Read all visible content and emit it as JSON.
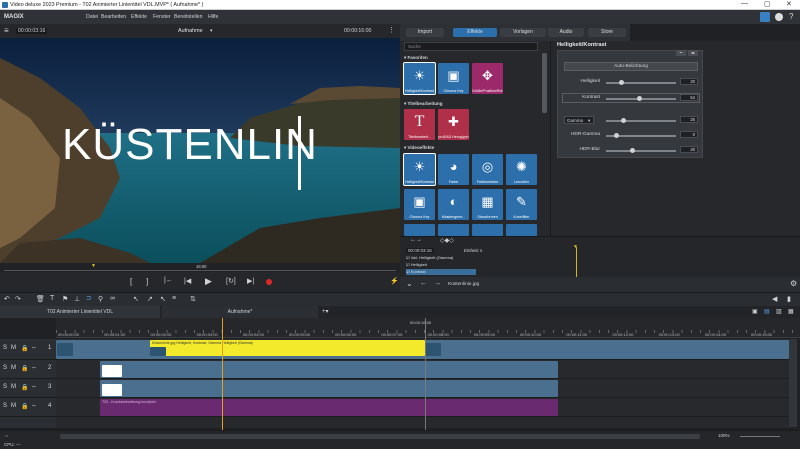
{
  "window": {
    "title": "Video deluxe 2023 Premium - T02 Animierter Linientitel VDL.MVP* ( Aufnahme* )"
  },
  "menubar": {
    "logo": "MAGIX",
    "items": [
      "Datei",
      "Bearbeiten",
      "Effekte",
      "Fenster",
      "Bereitstellen",
      "Hilfe"
    ]
  },
  "preview": {
    "timecode_left": "00:00:03:16",
    "title": "Aufnahme",
    "timecode_right": "00:00:16:00",
    "overlay_text": "KÜSTENLIN",
    "position_label": "16:00"
  },
  "tabs": [
    "Import",
    "Effekte",
    "Vorlagen",
    "Audio",
    "Store"
  ],
  "active_tab": "Effekte",
  "search": {
    "placeholder": "Suche"
  },
  "effects": {
    "sections": [
      {
        "title": "Favoriten",
        "tiles": [
          "Helligkeit/Kontrast",
          "Chroma Key",
          "Größe/Position/Rot..."
        ]
      },
      {
        "title": "Titelbearbeitung",
        "tiles": [
          "Titelbearbeit...",
          "proDAD Heroglyph"
        ]
      },
      {
        "title": "Videoeffekte",
        "tiles": [
          "Helligkeit/Kontrast",
          "Farbe",
          "Farbkorrektur",
          "Leuchten",
          "Chroma Key",
          "Maskengene...",
          "Stanzformen",
          "Kunstfilter"
        ]
      }
    ]
  },
  "properties": {
    "header": "Helligkeit/Kontrast",
    "auto_button": "Auto-Belichtung",
    "params": [
      {
        "label": "Helligkeit",
        "value": "20",
        "fill": 0.18
      },
      {
        "label": "Kontrast",
        "value": "54",
        "fill": 0.45
      },
      {
        "label": "Gamma",
        "value": "25",
        "fill": 0.22
      },
      {
        "label": "HDR-Gamma",
        "value": "0",
        "fill": 0.12
      },
      {
        "label": "HDR-Blur",
        "value": "40",
        "fill": 0.35
      }
    ],
    "dropdown_value": "Gamma"
  },
  "keyframes": {
    "timecode": "00:00:03:16",
    "unit_label": "Einheit:",
    "unit_value": "s",
    "rows": [
      "Inkl. Helligkeit (Gamma)",
      "Helligkeit",
      "Kontrast"
    ],
    "footer_file": "Küstenlinie.jpg"
  },
  "timeline": {
    "project_tabs": [
      "T02 Animierter Linientitel VDL",
      "Aufnahme*"
    ],
    "ruler_marks": [
      "00:00:00:00",
      "00:00:01:00",
      "00:00:02:00",
      "00:00:03:00",
      "00:00:04:00",
      "00:00:05:00",
      "00:00:06:00",
      "00:00:07:00",
      "00:00:08:00",
      "00:00:09:00",
      "00:00:10:00",
      "00:00:11:00",
      "00:00:12:00",
      "00:00:13:00",
      "00:00:14:00",
      "00:00:15:00"
    ],
    "ruler_top": "00:00:16:00",
    "tracks": [
      "1",
      "2",
      "3",
      "4"
    ],
    "clips": [
      {
        "label": "Küstenlinie.jpg   Helligkeit, Kontrast, Gamma   Helligkeit (Gamma)"
      },
      {
        "label": "T02 - Kurzbeschreibung kurz/jetzt"
      }
    ],
    "zoom": "100%",
    "status": "CPU: —"
  },
  "colors": {
    "accent": "#2c6faa",
    "yellow_clip": "#f2ea2a",
    "purple_clip": "#6a2a70",
    "record": "#e02828"
  }
}
